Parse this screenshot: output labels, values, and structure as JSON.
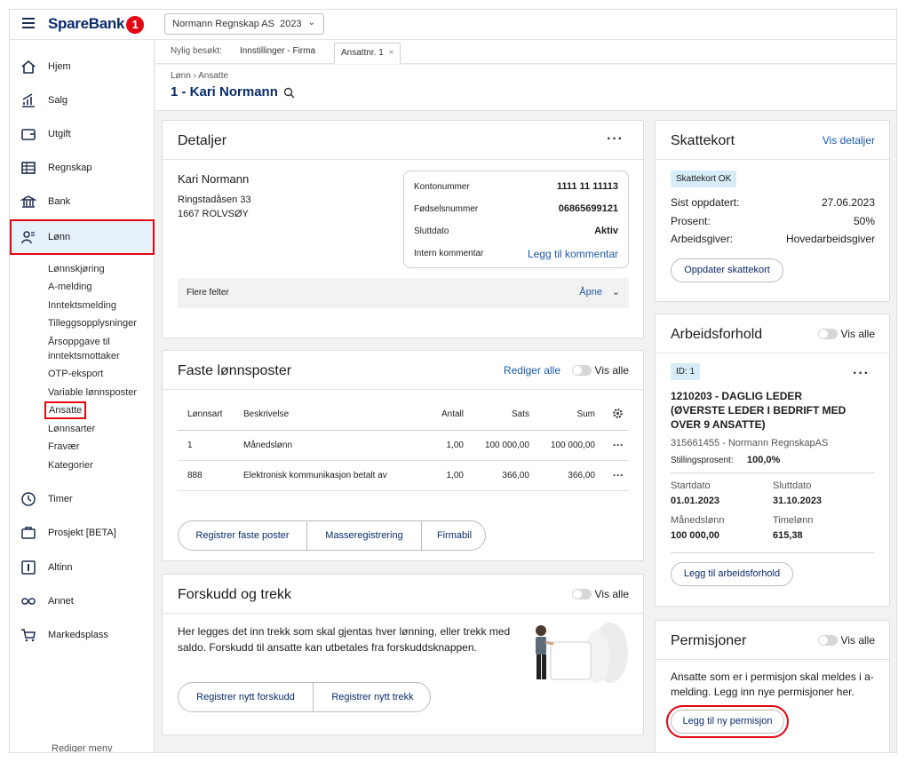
{
  "topbar": {
    "brand": "SpareBank",
    "brand_badge": "1",
    "company_select": "Normann Regnskap AS",
    "year": "2023"
  },
  "sidebar": {
    "items": [
      {
        "label": "Hjem",
        "icon": "home-icon"
      },
      {
        "label": "Salg",
        "icon": "chart-icon"
      },
      {
        "label": "Utgift",
        "icon": "wallet-icon"
      },
      {
        "label": "Regnskap",
        "icon": "ledger-icon"
      },
      {
        "label": "Bank",
        "icon": "bank-icon"
      },
      {
        "label": "Lønn",
        "icon": "people-icon"
      }
    ],
    "sub_items": [
      "Lønnskjøring",
      "A-melding",
      "Inntektsmelding",
      "Tilleggsopplysninger",
      "Årsoppgave til",
      "inntektsmottaker",
      "OTP-eksport",
      "Variable lønnsposter",
      "Ansatte",
      "Lønnsarter",
      "Fravær",
      "Kategorier"
    ],
    "items2": [
      {
        "label": "Timer",
        "icon": "clock-icon"
      },
      {
        "label": "Prosjekt [BETA]",
        "icon": "briefcase-icon"
      },
      {
        "label": "Altinn",
        "icon": "altinn-icon"
      },
      {
        "label": "Annet",
        "icon": "infinity-icon"
      },
      {
        "label": "Markedsplass",
        "icon": "cart-icon"
      }
    ],
    "footer": "Rediger meny"
  },
  "tabs": {
    "recent_label": "Nylig besøkt:",
    "recent_item": "Innstillinger - Firma",
    "active_tab": "Ansattnr. 1"
  },
  "header": {
    "breadcrumb": "Lønn › Ansatte",
    "title": "1 - Kari Normann"
  },
  "details": {
    "title": "Detaljer",
    "name": "Kari Normann",
    "address1": "Ringstadåsen 33",
    "address2": "1667 ROLVSØY",
    "fields": [
      {
        "label": "Kontonummer",
        "value": "1111 11 11113"
      },
      {
        "label": "Fødselsnummer",
        "value": "06865699121"
      },
      {
        "label": "Sluttdato",
        "value": "Aktiv"
      },
      {
        "label": "Intern kommentar",
        "value": "Legg til kommentar"
      }
    ],
    "more_fields": "Flere felter",
    "open": "Åpne"
  },
  "fixed": {
    "title": "Faste lønnsposter",
    "edit_all": "Rediger alle",
    "show_all": "Vis alle",
    "columns": [
      "Lønnsart",
      "Beskrivelse",
      "Antall",
      "Sats",
      "Sum"
    ],
    "rows": [
      {
        "art": "1",
        "desc": "Månedslønn",
        "antall": "1,00",
        "sats": "100 000,00",
        "sum": "100 000,00"
      },
      {
        "art": "888",
        "desc": "Elektronisk kommunikasjon betalt av",
        "antall": "1,00",
        "sats": "366,00",
        "sum": "366,00"
      }
    ],
    "btn_register": "Registrer faste poster",
    "btn_mass": "Masseregistrering",
    "btn_car": "Firmabil"
  },
  "advance": {
    "title": "Forskudd og trekk",
    "show_all": "Vis alle",
    "text": "Her legges det inn trekk som skal gjentas hver lønning, eller trekk med saldo. Forskudd til ansatte kan utbetales fra forskuddsknappen.",
    "btn_advance": "Registrer nytt forskudd",
    "btn_deduction": "Registrer nytt trekk"
  },
  "tax": {
    "title": "Skattekort",
    "link": "Vis detaljer",
    "badge": "Skattekort OK",
    "rows": [
      {
        "label": "Sist oppdatert:",
        "value": "27.06.2023"
      },
      {
        "label": "Prosent:",
        "value": "50%"
      },
      {
        "label": "Arbeidsgiver:",
        "value": "Hovedarbeidsgiver"
      }
    ],
    "button": "Oppdater skattekort"
  },
  "employment": {
    "title": "Arbeidsforhold",
    "show_all": "Vis alle",
    "id_badge": "ID: 1",
    "position_l1": "1210203 - DAGLIG LEDER",
    "position_l2": "(ØVERSTE LEDER I BEDRIFT MED",
    "position_l3": "OVER 9 ANSATTE)",
    "org": "315661455 - Normann RegnskapAS",
    "pct_label": "Stillingsprosent:",
    "pct_value": "100,0%",
    "start_label": "Startdato",
    "start_value": "01.01.2023",
    "end_label": "Sluttdato",
    "end_value": "31.10.2023",
    "monthly_label": "Månedslønn",
    "monthly_value": "100 000,00",
    "hourly_label": "Timelønn",
    "hourly_value": "615,38",
    "button": "Legg til arbeidsforhold"
  },
  "leave": {
    "title": "Permisjoner",
    "show_all": "Vis alle",
    "text": "Ansatte som er i permisjon skal meldes i a-melding. Legg inn nye permisjoner her.",
    "button": "Legg til ny permisjon"
  }
}
